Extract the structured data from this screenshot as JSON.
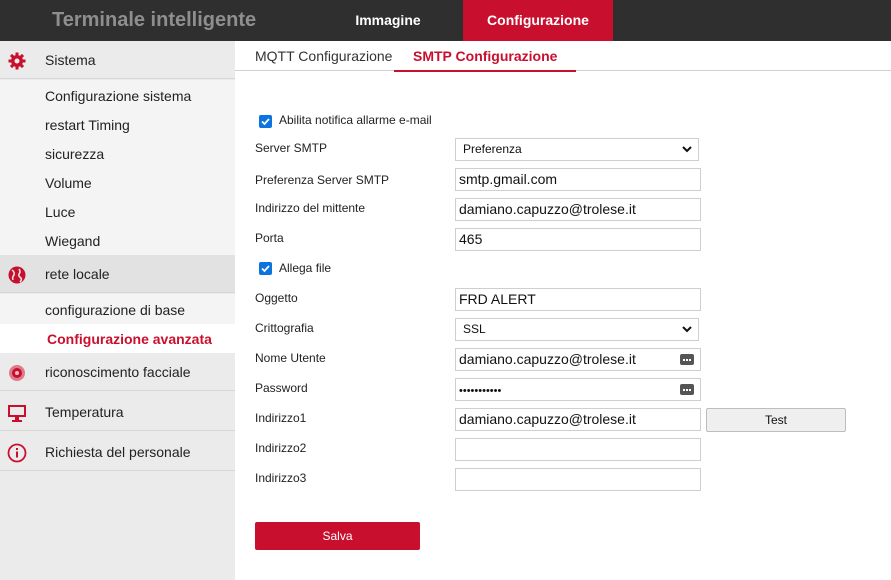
{
  "header": {
    "title": "Terminale intelligente",
    "tabs": [
      {
        "label": "Immagine"
      },
      {
        "label": "Configurazione"
      }
    ]
  },
  "sidebar": {
    "sections": [
      {
        "label": "Sistema",
        "icon": "gear-icon",
        "items": [
          "Configurazione sistema",
          "restart Timing",
          "sicurezza",
          "Volume",
          "Luce",
          "Wiegand"
        ]
      },
      {
        "label": "rete locale",
        "icon": "globe-icon",
        "items": [
          "configurazione di base",
          "Configurazione avanzata"
        ]
      },
      {
        "label": "riconoscimento facciale",
        "icon": "face-recognition-icon",
        "items": []
      },
      {
        "label": "Temperatura",
        "icon": "monitor-icon",
        "items": []
      },
      {
        "label": "Richiesta del personale",
        "icon": "info-icon",
        "items": []
      }
    ],
    "active_item": "Configurazione avanzata"
  },
  "content_tabs": [
    "MQTT Configurazione",
    "SMTP Configurazione"
  ],
  "form": {
    "enable_email": {
      "label": "Abilita notifica allarme e-mail",
      "checked": true
    },
    "smtp_server": {
      "label": "Server SMTP",
      "value": "Preferenza"
    },
    "smtp_pref_server": {
      "label": "Preferenza Server SMTP",
      "value": "smtp.gmail.com"
    },
    "sender": {
      "label": "Indirizzo del mittente",
      "value": "damiano.capuzzo@trolese.it"
    },
    "port": {
      "label": "Porta",
      "value": "465"
    },
    "attach": {
      "label": "Allega file",
      "checked": true
    },
    "subject": {
      "label": "Oggetto",
      "value": "FRD ALERT"
    },
    "encryption": {
      "label": "Crittografia",
      "value": "SSL"
    },
    "username": {
      "label": "Nome Utente",
      "value": "damiano.capuzzo@trolese.it"
    },
    "password": {
      "label": "Password",
      "value": "•••••••••••"
    },
    "address1": {
      "label": "Indirizzo1",
      "value": "damiano.capuzzo@trolese.it"
    },
    "address2": {
      "label": "Indirizzo2",
      "value": ""
    },
    "address3": {
      "label": "Indirizzo3",
      "value": ""
    },
    "test_label": "Test",
    "save_label": "Salva"
  },
  "colors": {
    "accent": "#c8102e",
    "header_bg": "#2f2f2f",
    "sidebar_bg": "#ebebeb",
    "checkbox": "#0b74de"
  }
}
